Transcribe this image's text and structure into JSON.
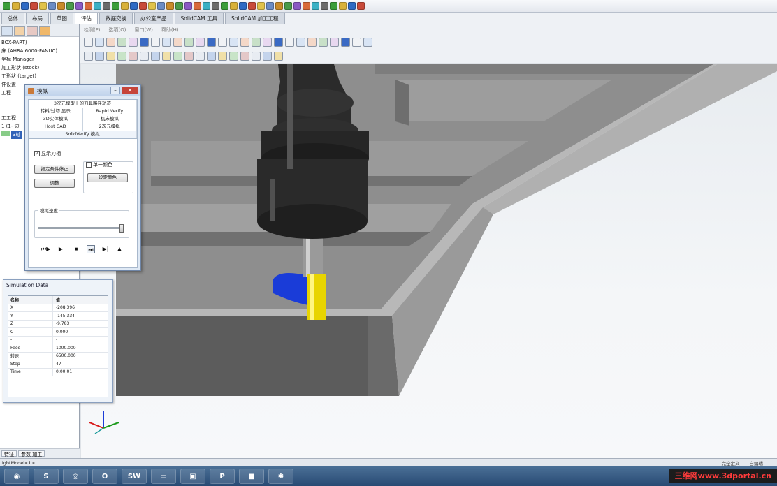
{
  "colors": {
    "taskbar": "#2f5680",
    "viewport_bg": "#eef1f4",
    "part_gray": "#8c8c8c",
    "holder_dark": "#2a2a2a",
    "tool_yellow": "#e8d400",
    "chip_blue": "#1a3cd8",
    "selection_blue": "#3162b8",
    "watermark_red": "#ff3b3b"
  },
  "tabs": [
    {
      "label": "总体"
    },
    {
      "label": "布局"
    },
    {
      "label": "草图"
    },
    {
      "label": "评估",
      "active": true
    },
    {
      "label": "数据交换"
    },
    {
      "label": "办公室产品"
    },
    {
      "label": "SolidCAM 工具"
    },
    {
      "label": "SolidCAM 加工工程"
    }
  ],
  "tree": {
    "items": [
      "BOX-PART)",
      "床 (AHRA 6000-FANUC)",
      "坐标 Manager",
      "加工形状 (stock)",
      "工形状 (target)",
      "件设置",
      "",
      "工程",
      "",
      "",
      "工工程",
      "1 (1- 边",
      "3轴"
    ]
  },
  "left_bottom_tabs": [
    "特征",
    "参数 加工"
  ],
  "cad_menu": [
    "检测(F)",
    "选项(O)",
    "窗口(W)",
    "帮助(H)"
  ],
  "dialog": {
    "title": "模拟",
    "tabs": [
      "3次元模型上的刀具路径轨迹",
      "转料/过切 显示",
      "Rapid Verify",
      "3D实体模拟",
      "机床模拟",
      "Host CAD",
      "2次元模拟",
      "SolidVerify 模拟"
    ],
    "show_material_label": "显示刀柄",
    "show_material_check": "✓",
    "specify_stop_button": "指定条件停止",
    "single_color_label": "单一颜色",
    "adjust_button": "调整",
    "set_color_button": "设定颜色",
    "speed_group_label": "模拟速度",
    "speed_level": 1.0,
    "playback": [
      "⏮▶",
      "▶",
      "■",
      "⏭",
      "▶|",
      "▲"
    ]
  },
  "sim_data": {
    "title": "Simulation Data",
    "header": {
      "name": "名称",
      "value": "值"
    },
    "rows": [
      {
        "name": "X",
        "value": "-208.396"
      },
      {
        "name": "Y",
        "value": "-145.334"
      },
      {
        "name": "Z",
        "value": "-9.783"
      },
      {
        "name": "C",
        "value": "0.000"
      },
      {
        "name": "-",
        "value": "-"
      },
      {
        "name": "Feed",
        "value": "1000.000"
      },
      {
        "name": "转速",
        "value": "6500.000"
      },
      {
        "name": "Step",
        "value": "47"
      },
      {
        "name": "Time",
        "value": "0:00:01"
      }
    ]
  },
  "status": {
    "left": "ightModel<1>",
    "right1": "完全定义",
    "right2": "自编辑"
  },
  "taskbar": {
    "items": [
      {
        "name": "chrome-icon",
        "glyph": "◉"
      },
      {
        "name": "skype-icon",
        "glyph": "S"
      },
      {
        "name": "app-icon",
        "glyph": "◎"
      },
      {
        "name": "outlook-icon",
        "glyph": "O"
      },
      {
        "name": "solidworks-icon",
        "glyph": "SW"
      },
      {
        "name": "folder-icon",
        "glyph": "▭"
      },
      {
        "name": "app2-icon",
        "glyph": "▣"
      },
      {
        "name": "powerpoint-icon",
        "glyph": "P"
      },
      {
        "name": "app3-icon",
        "glyph": "■"
      },
      {
        "name": "app4-icon",
        "glyph": "✱"
      }
    ],
    "watermark": "三维网www.3dportal.cn"
  }
}
